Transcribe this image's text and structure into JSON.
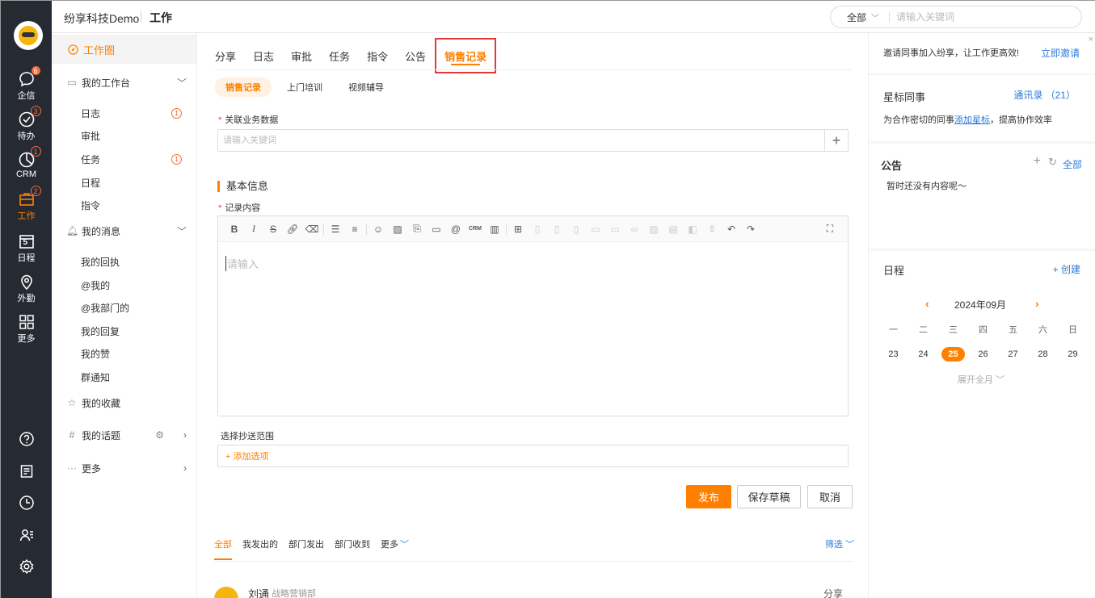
{
  "header": {
    "company": "纷享科技Demo",
    "section": "工作",
    "search_scope": "全部",
    "search_placeholder": "请输入关键词"
  },
  "rail": {
    "items": [
      {
        "label": "企信",
        "badge": "6"
      },
      {
        "label": "待办",
        "badge": "3"
      },
      {
        "label": "CRM",
        "badge": "1"
      },
      {
        "label": "工作",
        "badge": "2"
      },
      {
        "label": "日程",
        "day": "5"
      },
      {
        "label": "外勤"
      },
      {
        "label": "更多"
      }
    ]
  },
  "subnav": {
    "workspace": "工作圈",
    "my_workbench": "我的工作台",
    "workbench_items": [
      {
        "label": "日志",
        "count": "1"
      },
      {
        "label": "审批"
      },
      {
        "label": "任务",
        "count": "1"
      },
      {
        "label": "日程"
      },
      {
        "label": "指令"
      }
    ],
    "my_messages": "我的消息",
    "message_items": [
      "我的回执",
      "@我的",
      "@我部门的",
      "我的回复",
      "我的赞",
      "群通知"
    ],
    "favorites": "我的收藏",
    "topics": "我的话题",
    "more": "更多"
  },
  "main": {
    "tabs": [
      "分享",
      "日志",
      "审批",
      "任务",
      "指令",
      "公告",
      "销售记录"
    ],
    "pills": [
      "销售记录",
      "上门培训",
      "视频辅导"
    ],
    "related_label": "关联业务数据",
    "related_placeholder": "请输入关键词",
    "basic_info": "基本信息",
    "content_label": "记录内容",
    "editor_placeholder": "请输入",
    "cc_label": "选择抄送范围",
    "cc_add": "+ 添加选项",
    "publish": "发布",
    "save_draft": "保存草稿",
    "cancel": "取消",
    "filter_tabs": [
      "全部",
      "我发出的",
      "部门发出",
      "部门收到",
      "更多"
    ],
    "filter": "筛选",
    "feed": {
      "name": "刘通",
      "dept": "战略营销部",
      "action": "分享"
    }
  },
  "right": {
    "invite_text": "邀请同事加入纷享，让工作更高效!",
    "invite_link": "立即邀请",
    "starred_title": "星标同事",
    "contacts_link": "通讯录 （21）",
    "starred_desc_before": "为合作密切的同事",
    "starred_desc_link": "添加星标",
    "starred_desc_after": "，提高协作效率",
    "notice_title": "公告",
    "notice_all": "全部",
    "notice_empty": "暂时还没有内容呢～",
    "schedule_title": "日程",
    "schedule_create": "+ 创建",
    "calendar_month": "2024年09月",
    "weekdays": [
      "一",
      "二",
      "三",
      "四",
      "五",
      "六",
      "日"
    ],
    "days": [
      "23",
      "24",
      "25",
      "26",
      "27",
      "28",
      "29"
    ],
    "expand": "展开全月"
  },
  "colors": {
    "accent": "#ff8000",
    "link": "#2b7bdc",
    "rail": "#262a33",
    "highlight_box": "#e03a3a"
  }
}
